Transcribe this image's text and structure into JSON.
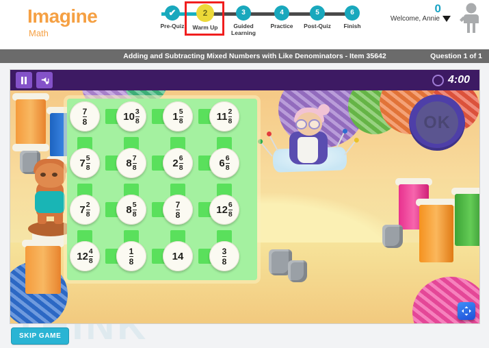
{
  "brand": {
    "name": "Imagine",
    "subtitle": "Math"
  },
  "stepper": {
    "steps": [
      {
        "num": "1",
        "label": "Pre-Quiz",
        "state": "done"
      },
      {
        "num": "2",
        "label": "Warm Up",
        "state": "active"
      },
      {
        "num": "3",
        "label": "Guided Learning",
        "state": "todo"
      },
      {
        "num": "4",
        "label": "Practice",
        "state": "todo"
      },
      {
        "num": "5",
        "label": "Post-Quiz",
        "state": "todo"
      },
      {
        "num": "6",
        "label": "Finish",
        "state": "todo"
      }
    ],
    "highlight_color": "#f01e1e",
    "active_color": "#ecd938",
    "done_color": "#19a8bd"
  },
  "user": {
    "score": "0",
    "welcome": "Welcome, Annie",
    "caret": "caret-down-icon",
    "avatar": "avatar-icon"
  },
  "titlebar": {
    "title": "Adding and Subtracting Mixed Numbers with Like Denominators - Item 35642",
    "question_count": "Question 1 of 1"
  },
  "game_bar": {
    "pause_label": "pause-icon",
    "audio_label": "audio-icon",
    "timer": "4:00",
    "timer_icon": "timer-circle-icon"
  },
  "game": {
    "ok_label": "OK",
    "fullscreen_icon": "fullscreen-arrows-icon",
    "background_watermark": "THINK",
    "board": {
      "rows": [
        [
          {
            "whole": "",
            "num": "7",
            "den": "8"
          },
          {
            "whole": "10",
            "num": "3",
            "den": "8"
          },
          {
            "whole": "1",
            "num": "5",
            "den": "8"
          },
          {
            "whole": "11",
            "num": "2",
            "den": "8"
          }
        ],
        [
          {
            "whole": "7",
            "num": "5",
            "den": "8"
          },
          {
            "whole": "8",
            "num": "7",
            "den": "8"
          },
          {
            "whole": "2",
            "num": "6",
            "den": "8"
          },
          {
            "whole": "6",
            "num": "6",
            "den": "8"
          }
        ],
        [
          {
            "whole": "7",
            "num": "2",
            "den": "8"
          },
          {
            "whole": "8",
            "num": "5",
            "den": "8"
          },
          {
            "whole": "",
            "num": "7",
            "den": "8"
          },
          {
            "whole": "12",
            "num": "6",
            "den": "8"
          }
        ],
        [
          {
            "whole": "12",
            "num": "4",
            "den": "8"
          },
          {
            "whole": "",
            "num": "1",
            "den": "8"
          },
          {
            "whole": "14",
            "num": "",
            "den": ""
          },
          {
            "whole": "",
            "num": "3",
            "den": "8"
          }
        ]
      ]
    }
  },
  "footer": {
    "skip_label": "SKIP GAME"
  }
}
